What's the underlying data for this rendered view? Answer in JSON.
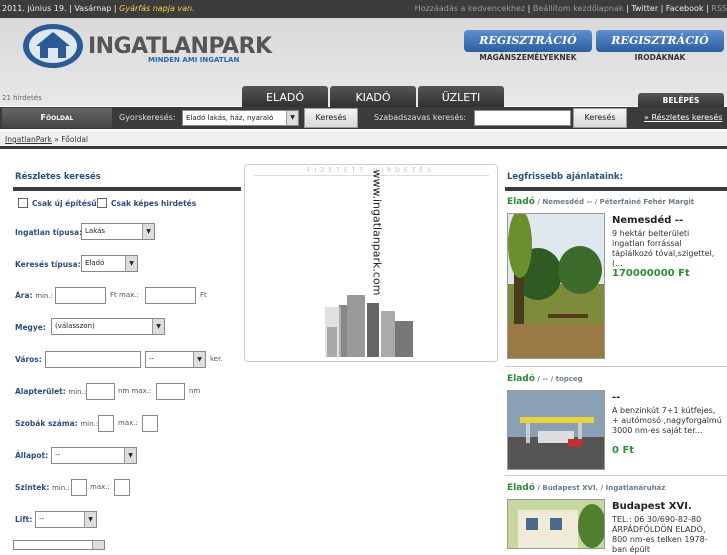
{
  "topbar": {
    "date": "2011. június 19.",
    "sep1": " | ",
    "day": "Vasárnap",
    "sep2": " | ",
    "nameday": "Gyárfás napja van.",
    "links": [
      "Hozzáadás a kedvencekhez",
      "Beállítom kezdőlapnak",
      "Twitter",
      "Facebook",
      "RSS"
    ]
  },
  "logo": {
    "name": "INGATLANPARK",
    "tagline": "MINDEN AMI INGATLAN"
  },
  "register": [
    {
      "label": "REGISZTRÁCIÓ",
      "sub": "MAGÁNSZEMÉLYEKNEK"
    },
    {
      "label": "REGISZTRÁCIÓ",
      "sub": "IRODÁKNAK"
    }
  ],
  "ad_count": "21 hirdetés",
  "tabs": [
    "ELADÓ",
    "KIADÓ",
    "ÜZLETI"
  ],
  "login": "BELÉPÉS",
  "nav": {
    "home": "Főoldal",
    "quick_label": "Gyorskeresés:",
    "quick_value": "Eladó lakás, ház, nyaraló",
    "search_btn": "Keresés",
    "free_label": "Szabadszavas keresés:",
    "free_placeholder": "",
    "search_btn2": "Keresés",
    "detailed": "» Részletes keresés"
  },
  "breadcrumb": {
    "root": "IngatlanPark",
    "sep": " » ",
    "current": "Főoldal"
  },
  "form": {
    "title": "Részletes keresés",
    "new_only": "Csak új építésű",
    "with_pics": "Csak képes hirdetés",
    "type_label": "Ingatlan típusa:",
    "type_value": "Lakás",
    "search_type_label": "Keresés típusa:",
    "search_type_value": "Eladó",
    "price_label": "Ára:",
    "min": "min.:",
    "ft_max": "Ft max.:",
    "ft": "Ft",
    "county_label": "Megye:",
    "county_value": "(válasszon)",
    "city_label": "Város:",
    "city_sel": "--",
    "ker": "ker.",
    "area_label": "Alapterület:",
    "area_min": "min.:",
    "nm_max": "nm max.:",
    "nm": "nm",
    "rooms_label": "Szobák száma:",
    "rooms_min": "min.:",
    "rooms_max": "max.:",
    "state_label": "Állapot:",
    "state_value": "--",
    "floors_label": "Szintek:",
    "floors_min": "min.:",
    "floors_max": "max.:",
    "lift_label": "Lift:",
    "lift_value": "--"
  },
  "ad": {
    "header": "FIZETETT HIRDETÉS",
    "url": "www.ingatlanpark.com"
  },
  "offers": {
    "title": "Legfrissebb ajánlataink:",
    "items": [
      {
        "cat": "Eladó",
        "sub": " / Nemesdéd -- / Péterfainé Fehér Margit",
        "title": "Nemesdéd --",
        "desc": "9 hektár belterületi ingatlan forrással táplálkozó tóval,szigettel, (...",
        "price": "170000000 Ft"
      },
      {
        "cat": "Eladó",
        "sub": " / -- / topceg",
        "title": "--",
        "desc": "A benzinkút 7+1 kútfejes, + autómosó ,nagyforgalmú 3000 nm-es saját ter...",
        "price": "0 Ft"
      },
      {
        "cat": "Eladó",
        "sub": " / Budapest XVI. / Ingatlanáruház",
        "title": "Budapest XVI.",
        "desc": "TEL.: 06 30/690-82-80 ÁRPÁDFÖLDÖN ELADÓ, 800 nm-es telken 1978-ban épült",
        "price": ""
      }
    ]
  },
  "colors": {
    "accent": "#2a67b3",
    "green": "#2e8b3b",
    "dark": "#3b3b3b"
  }
}
